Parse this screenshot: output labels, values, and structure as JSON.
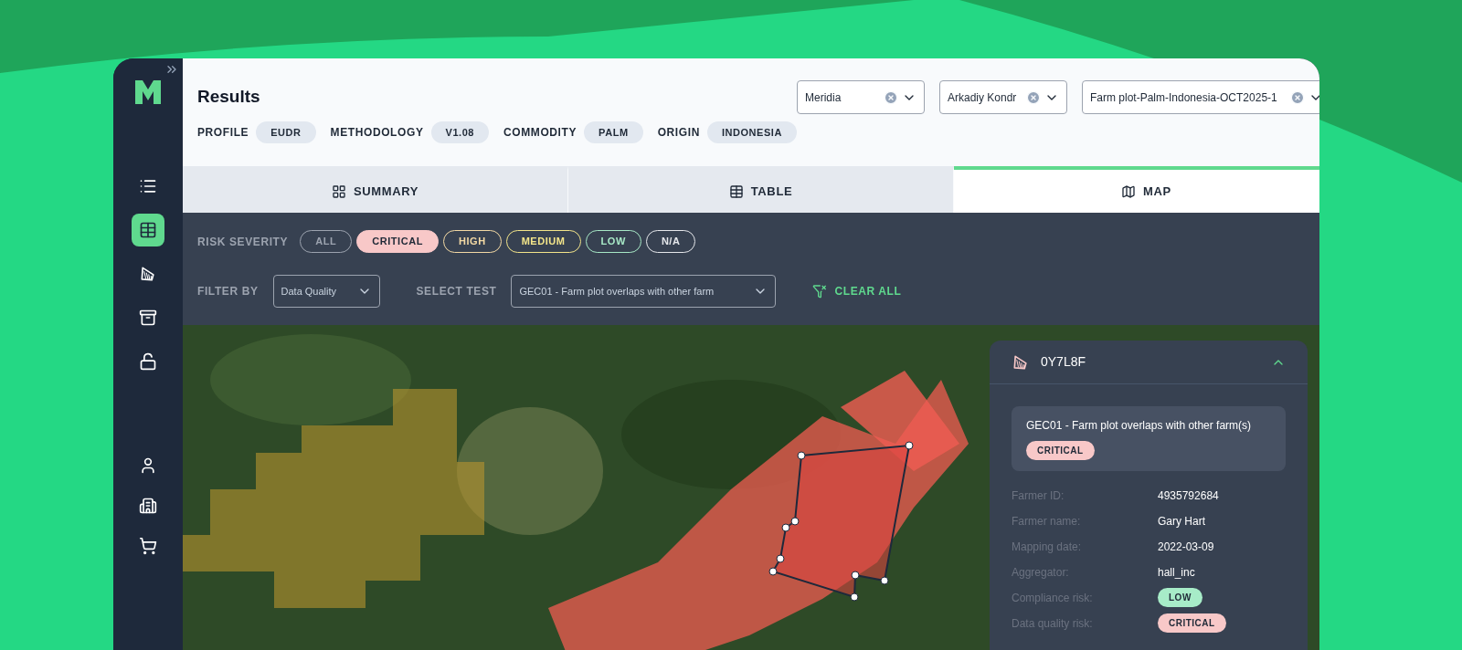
{
  "sidebar": {
    "items": [
      {
        "selected": false
      },
      {
        "selected": true
      },
      {
        "selected": false
      },
      {
        "selected": false
      },
      {
        "selected": false
      }
    ]
  },
  "header": {
    "title": "Results",
    "tags": [
      {
        "label": "PROFILE",
        "value": "EUDR"
      },
      {
        "label": "METHODOLOGY",
        "value": "V1.08"
      },
      {
        "label": "COMMODITY",
        "value": "PALM"
      },
      {
        "label": "ORIGIN",
        "value": "INDONESIA"
      }
    ],
    "selects": [
      {
        "value": "Meridia"
      },
      {
        "value": "Arkadiy Kondr"
      },
      {
        "value": "Farm plot-Palm-Indonesia-OCT2025-1"
      }
    ]
  },
  "tabs": [
    {
      "label": "SUMMARY",
      "selected": false
    },
    {
      "label": "TABLE",
      "selected": false
    },
    {
      "label": "MAP",
      "selected": true
    }
  ],
  "filters": {
    "severity_label": "RISK SEVERITY",
    "severities": [
      {
        "label": "ALL",
        "color": "#9ca3af",
        "selected": false
      },
      {
        "label": "CRITICAL",
        "color": "#f8c8c8",
        "selected": true
      },
      {
        "label": "HIGH",
        "color": "#f3d9a4",
        "selected": false
      },
      {
        "label": "MEDIUM",
        "color": "#f3e58a",
        "selected": false
      },
      {
        "label": "LOW",
        "color": "#a7e8c6",
        "selected": false
      },
      {
        "label": "N/A",
        "color": "#e5e7eb",
        "selected": false
      }
    ],
    "filter_by_label": "FILTER BY",
    "filter_by_value": "Data Quality",
    "select_test_label": "SELECT TEST",
    "select_test_value": "GEC01 - Farm plot overlaps with other farm",
    "clear_label": "CLEAR ALL"
  },
  "details": {
    "title": "0Y7L8F",
    "expanded": true,
    "test": {
      "name": "GEC01 - Farm plot overlaps with other farm(s)",
      "severity": "CRITICAL",
      "color": "#f8c8c8"
    },
    "fields": [
      {
        "label": "Farmer ID:",
        "value": "4935792684",
        "kind": "text"
      },
      {
        "label": "Farmer name:",
        "value": "Gary Hart",
        "kind": "text"
      },
      {
        "label": "Mapping date:",
        "value": "2022-03-09",
        "kind": "text"
      },
      {
        "label": "Aggregator:",
        "value": "hall_inc",
        "kind": "text"
      },
      {
        "label": "Compliance risk:",
        "value": "LOW",
        "kind": "badge",
        "color": "#a7ecc8"
      },
      {
        "label": "Data quality risk:",
        "value": "CRITICAL",
        "kind": "badge",
        "color": "#f8c8c8"
      }
    ]
  }
}
